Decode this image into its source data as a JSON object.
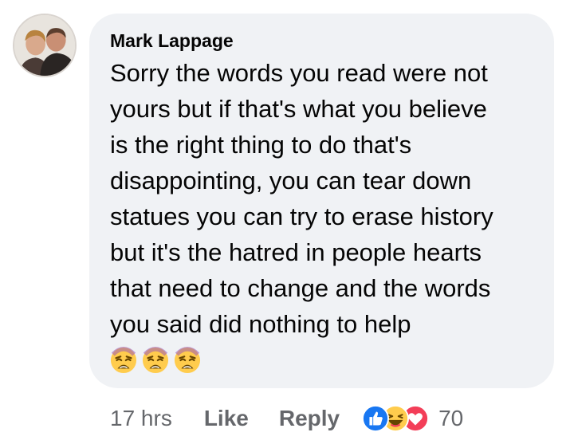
{
  "comment": {
    "author": "Mark Lappage",
    "text": "Sorry the words you read were not\nyours but if that's what you believe\nis the right thing to do that's\ndisappointing, you can tear down\nstatues you can try to erase history\nbut it's the hatred in people hearts\nthat need to change and the words\nyou said did nothing to help",
    "emojis": [
      "weary-face",
      "weary-face",
      "weary-face"
    ],
    "avatar": "profile-photo-two-people"
  },
  "actions": {
    "time": "17 hrs",
    "like_label": "Like",
    "reply_label": "Reply"
  },
  "reactions": {
    "types": [
      "like",
      "haha",
      "love"
    ],
    "count": "70"
  },
  "colors": {
    "bubble": "#f0f2f5",
    "text": "#050505",
    "secondary_text": "#65676b",
    "like_blue": "#1877f2",
    "love_red": "#f33e58",
    "emoji_yellow": "#ffcc4d"
  }
}
